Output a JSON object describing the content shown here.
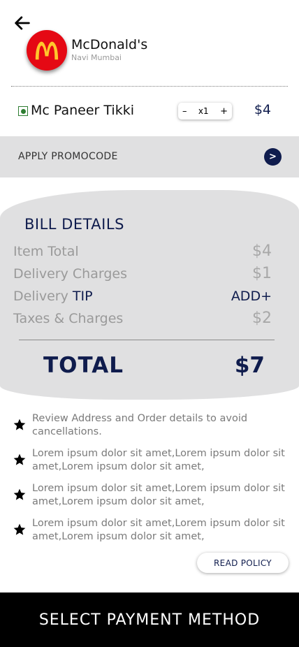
{
  "header": {
    "back_icon": "arrow-left-icon",
    "logo_icon": "mcdonalds-logo",
    "restaurant_name": "McDonald's",
    "location": "Navi Mumbai"
  },
  "cart": {
    "items": [
      {
        "name": "Mc Paneer Tikki",
        "veg": true,
        "qty_minus": "–",
        "qty": "x1",
        "qty_plus": "+",
        "price": "$4"
      }
    ]
  },
  "promo": {
    "label": "APPLY PROMOCODE",
    "go_symbol": ">"
  },
  "bill": {
    "title": "BILL DETAILS",
    "rows": [
      {
        "label": "Item Total",
        "value": "$4"
      },
      {
        "label": "Delivery Charges",
        "value": "$1"
      },
      {
        "label_prefix": "Delivery",
        "label_highlight": "TIP",
        "value": "ADD+"
      },
      {
        "label": "Taxes & Charges",
        "value": "$2"
      }
    ],
    "total_label": "TOTAL",
    "total_value": "$7"
  },
  "notes": [
    "Review Address and Order details to avoid cancellations.",
    "Lorem ipsum dolor sit amet,Lorem ipsum dolor sit amet,Lorem ipsum dolor sit amet,",
    "Lorem ipsum dolor sit amet,Lorem ipsum dolor sit amet,Lorem ipsum dolor sit amet,",
    "Lorem ipsum dolor sit amet,Lorem ipsum dolor sit amet,Lorem ipsum dolor sit amet,"
  ],
  "policy_button": "READ POLICY",
  "payment_button": "SELECT PAYMENT METHOD",
  "colors": {
    "accent": "#0f1c4d",
    "brand_red": "#e50914",
    "brand_yellow": "#ffc72c",
    "panel_gray": "#e0e0e1",
    "veg_green": "#2e7d32"
  }
}
